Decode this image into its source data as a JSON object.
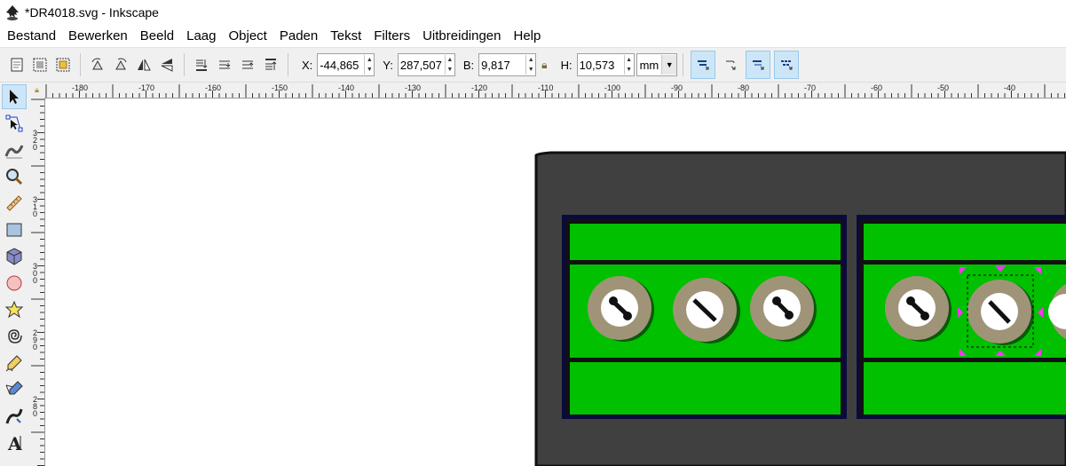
{
  "window": {
    "title": "*DR4018.svg - Inkscape",
    "app_icon": "inkscape-icon"
  },
  "menu": [
    "Bestand",
    "Bewerken",
    "Beeld",
    "Laag",
    "Object",
    "Paden",
    "Tekst",
    "Filters",
    "Uitbreidingen",
    "Help"
  ],
  "toolbar": {
    "x_label": "X:",
    "x_value": "-44,865",
    "y_label": "Y:",
    "y_value": "287,507",
    "w_label": "B:",
    "w_value": "9,817",
    "h_label": "H:",
    "h_value": "10,573",
    "unit": "mm"
  },
  "ruler": {
    "horizontal_labels": [
      "-180",
      "-170",
      "-160",
      "-150",
      "-140",
      "-130",
      "-120",
      "-110",
      "-100",
      "-90",
      "-80",
      "-70",
      "-60",
      "-50",
      "-40"
    ],
    "vertical_labels": [
      "320",
      "310",
      "300",
      "290",
      "280"
    ]
  },
  "tools": [
    "selector-tool-icon",
    "node-tool-icon",
    "tweak-tool-icon",
    "zoom-tool-icon",
    "measure-tool-icon",
    "rectangle-tool-icon",
    "3d-box-tool-icon",
    "ellipse-tool-icon",
    "star-tool-icon",
    "spiral-tool-icon",
    "pencil-tool-icon",
    "pen-tool-icon",
    "calligraphy-tool-icon",
    "text-tool-icon"
  ],
  "colors": {
    "board": "#404040",
    "terminal_green": "#00c000",
    "screw_ring": "#a09478",
    "selection_handle": "#ff33ff",
    "toggle_active": "#cde6f7"
  }
}
